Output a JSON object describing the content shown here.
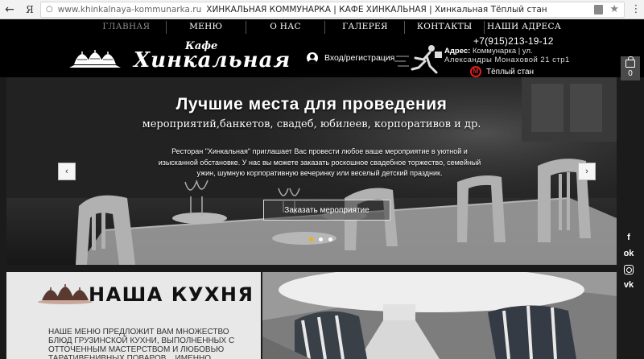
{
  "browser": {
    "back_icon": "←",
    "yandex_logo": "Я",
    "domain": "www.khinkalnaya-kommunarka.ru",
    "title": "ХИНКАЛЬНАЯ КОММУНАРКА | КАФЕ ХИНКАЛЬНАЯ | Хинкальная Тёплый стан",
    "star": "★",
    "menu_icon": "⋮"
  },
  "nav": {
    "items": [
      {
        "label": "ГЛАВНАЯ",
        "active": true
      },
      {
        "label": "МЕНЮ",
        "active": false
      },
      {
        "label": "О НАС",
        "active": false
      },
      {
        "label": "ГАЛЕРЕЯ",
        "active": false
      },
      {
        "label": "КОНТАКТЫ",
        "active": false
      },
      {
        "label": "НАШИ АДРЕСА",
        "active": false
      }
    ]
  },
  "logo": {
    "small": "Кафе",
    "big": "Хинкальная"
  },
  "login": {
    "label": "Вход/регистрация"
  },
  "contact": {
    "phone": "+7(915)213-19-12",
    "address_label": "Адрес:",
    "address_line1": "Коммунарка | ул.",
    "address_line2": "Александры Монаховой 21 стр1",
    "metro_letter": "М",
    "metro": "Тёплый стан"
  },
  "cart": {
    "count": "0"
  },
  "hero": {
    "title": "Лучшие места для проведения",
    "subtitle": "мероприятий,банкетов, свадеб, юбилеев, корпоративов и др.",
    "text": "Ресторан \"Хинкальная\" приглашает Вас провести любое ваше мероприятие в уютной и изысканной обстановке. У нас вы можете заказать роскошное свадебное торжество, семейный ужин, шумную корпоративную вечеринку или веселый детский праздник.",
    "button": "Заказать мероприятие",
    "prev": "‹",
    "next": "›",
    "slides_total": 3,
    "active_slide": 1
  },
  "kitchen": {
    "title": "НАША КУХНЯ",
    "text": "НАШЕ МЕНЮ ПРЕДЛОЖИТ ВАМ МНОЖЕСТВО БЛЮД ГРУЗИНСКОЙ КУХНИ, ВЫПОЛНЕННЫХ С ОТТОЧЕННЫМ МАСТЕРСТВОМ И ЛЮБОВЬЮ ТАРАТИВЕНИВНЫХ ПОВАРОВ... ИМЕННО"
  },
  "social": {
    "facebook": "f",
    "ok": "ok",
    "vk": "vk"
  },
  "colors": {
    "header_bg": "#000000",
    "accent_dot": "#f0b200",
    "metro_red": "#e02020"
  }
}
